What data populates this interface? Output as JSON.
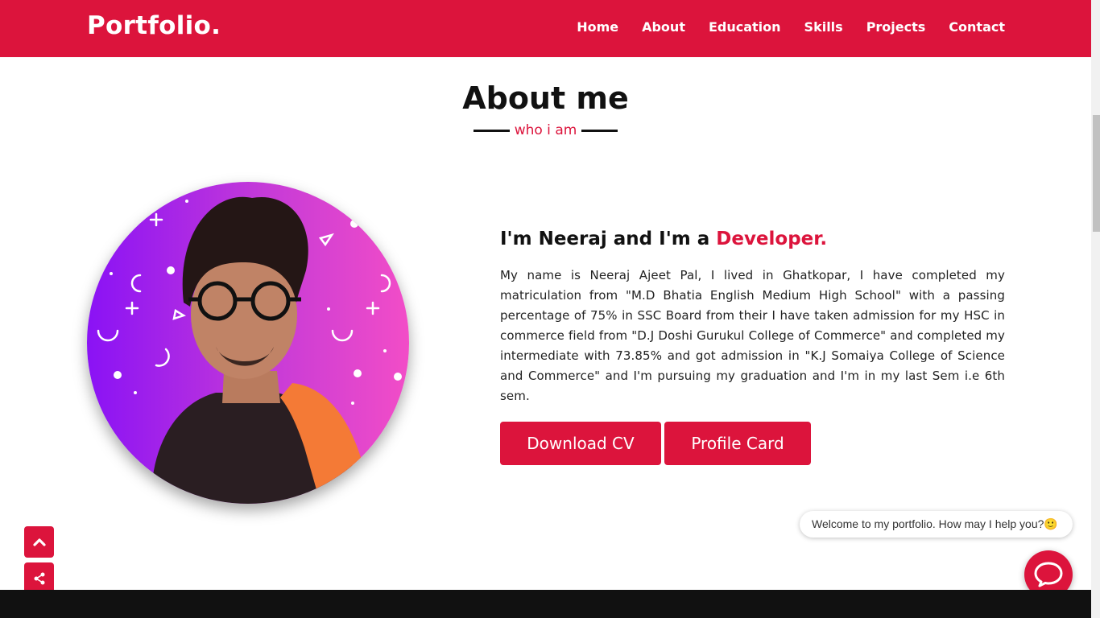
{
  "brand": {
    "logo": "Portfolio.",
    "accent_color": "#dc143c"
  },
  "nav": {
    "items": [
      {
        "label": "Home"
      },
      {
        "label": "About"
      },
      {
        "label": "Education"
      },
      {
        "label": "Skills"
      },
      {
        "label": "Projects"
      },
      {
        "label": "Contact"
      }
    ]
  },
  "about": {
    "title": "About me",
    "subtitle": "who i am",
    "intro_prefix": "I'm Neeraj and I'm a ",
    "intro_accent": "Developer.",
    "bio": "My name is Neeraj Ajeet Pal, I lived in Ghatkopar, I have completed my matriculation from \"M.D Bhatia English Medium High School\" with a passing percentage of 75% in SSC Board from their I have taken admission for my HSC in commerce field from \"D.J Doshi Gurukul College of Commerce\" and completed my intermediate with 73.85% and got admission in \"K.J Somaiya College of Science and Commerce\" and I'm pursuing my graduation and I'm in my last Sem i.e 6th sem.",
    "buttons": {
      "download_cv": "Download CV",
      "profile_card": "Profile Card"
    }
  },
  "chat": {
    "welcome": "Welcome to my portfolio. How may I help you?🙂"
  },
  "icons": {
    "to_top": "chevron-up-icon",
    "share": "share-icon",
    "chat": "chat-bubble-icon"
  }
}
